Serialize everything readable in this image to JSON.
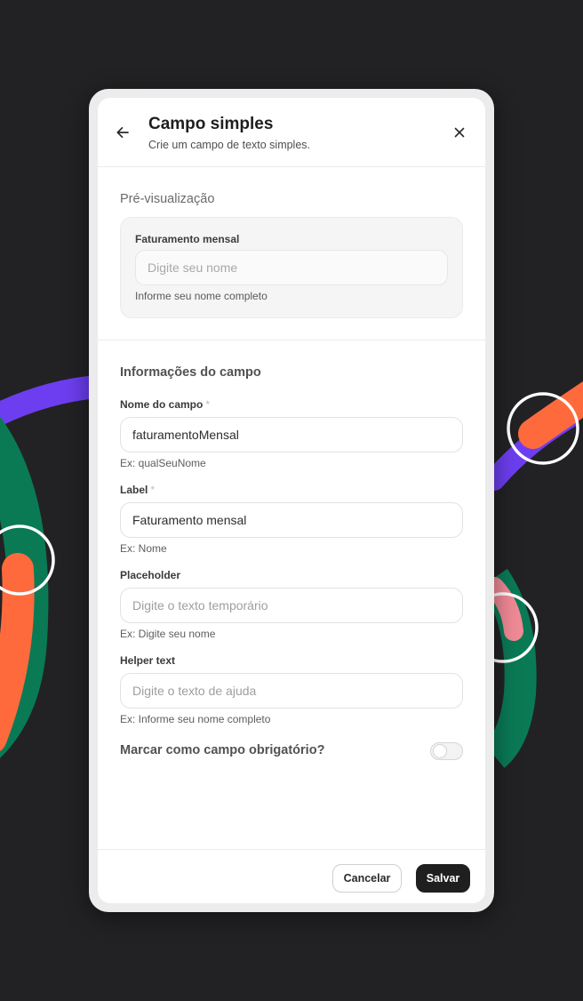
{
  "modal": {
    "title": "Campo simples",
    "subtitle": "Crie um campo de texto simples.",
    "back_icon": "arrow-left-icon",
    "close_icon": "close-icon"
  },
  "preview": {
    "heading": "Pré-visualização",
    "label": "Faturamento mensal",
    "placeholder": "Digite seu nome",
    "helper": "Informe seu nome completo"
  },
  "form": {
    "heading": "Informações do campo",
    "required_marker": "*",
    "fields": [
      {
        "label": "Nome do campo",
        "required": true,
        "value": "faturamentoMensal",
        "placeholder": "",
        "hint": "Ex: qualSeuNome"
      },
      {
        "label": "Label",
        "required": true,
        "value": "Faturamento mensal",
        "placeholder": "",
        "hint": "Ex: Nome"
      },
      {
        "label": "Placeholder",
        "required": false,
        "value": "",
        "placeholder": "Digite o texto temporário",
        "hint": "Ex: Digite seu nome"
      },
      {
        "label": "Helper text",
        "required": false,
        "value": "",
        "placeholder": "Digite o texto de ajuda",
        "hint": "Ex: Informe seu nome completo"
      }
    ],
    "required_toggle": {
      "label": "Marcar como campo obrigatório?",
      "checked": false
    }
  },
  "footer": {
    "cancel_label": "Cancelar",
    "save_label": "Salvar"
  },
  "colors": {
    "background": "#222224",
    "accent_purple": "#6d3ef0",
    "accent_orange": "#ff6a3d",
    "accent_green": "#0a7a55",
    "accent_pink": "#f08a96",
    "primary_button": "#1f1f1f"
  }
}
